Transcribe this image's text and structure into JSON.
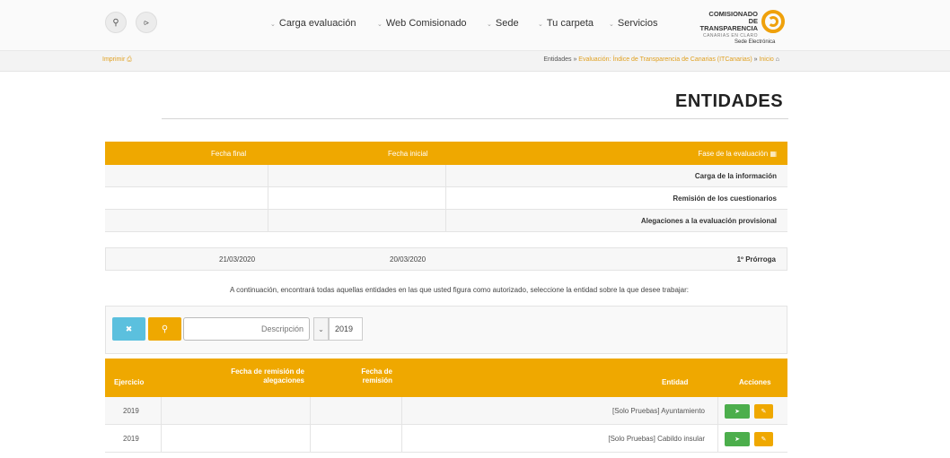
{
  "header": {
    "logo": {
      "line1": "COMISIONADO",
      "line2": "DE TRANSPARENCIA",
      "line3": "CANARIAS EN CLARO"
    },
    "sede": "Sede Electrónica",
    "nav": [
      "Servicios",
      "Tu carpeta",
      "Sede",
      "Web Comisionado",
      "Carga evaluación"
    ]
  },
  "breadcrumb": {
    "items": [
      "Inicio",
      "Evaluación: Índice de Transparencia de Canarias (ITCanarias)",
      "Entidades"
    ],
    "print": "Imprimir"
  },
  "page": {
    "title": "ENTIDADES"
  },
  "phases": {
    "headers": {
      "phase": "Fase de la evaluación",
      "start": "Fecha inicial",
      "end": "Fecha final"
    },
    "rows": [
      "Carga de la información",
      "Remisión de los cuestionarios",
      "Alegaciones a la evaluación provisional"
    ],
    "extension": {
      "label": "1º Prórroga",
      "start": "20/03/2020",
      "end": "21/03/2020"
    }
  },
  "intro_text": "A continuación, encontrará todas aquellas entidades en las que usted figura como autorizado, seleccione la entidad sobre la que desee trabajar:",
  "filter": {
    "year": "2019",
    "description_placeholder": "Descripción"
  },
  "entities": {
    "headers": {
      "actions": "Acciones",
      "entity": "Entidad",
      "remission_date": "Fecha de remisión",
      "allegations_date": "Fecha de remisión de alegaciones",
      "year": "Ejercicio"
    },
    "rows": [
      {
        "name": "[Solo Pruebas] Ayuntamiento",
        "year": "2019"
      },
      {
        "name": "[Solo Pruebas] Cabildo insular",
        "year": "2019"
      }
    ]
  },
  "colors": {
    "accent": "#efa800",
    "info": "#5bc0de",
    "success": "#4cae4c"
  }
}
